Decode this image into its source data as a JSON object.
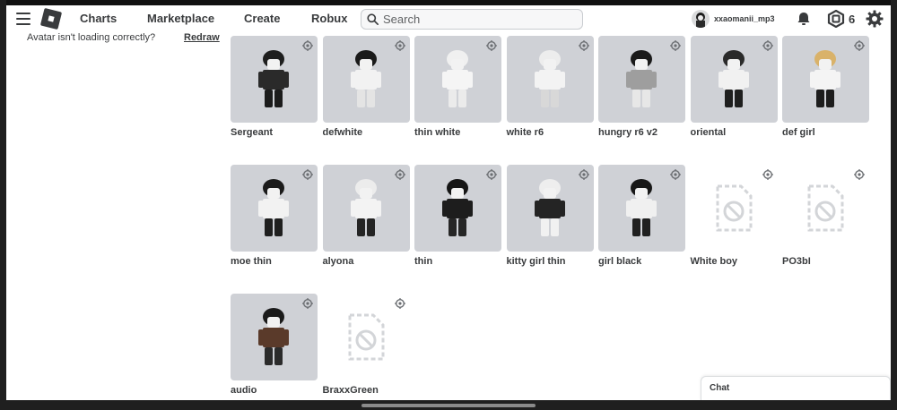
{
  "nav": {
    "menu_icon": "hamburger-icon",
    "logo_icon": "roblox-logo-icon",
    "links": [
      "Charts",
      "Marketplace",
      "Create",
      "Robux"
    ],
    "search_placeholder": "Search",
    "username": "xxaomanii_mp3",
    "robux_count": "6",
    "icons": [
      "bell-icon",
      "robux-icon",
      "gear-icon"
    ]
  },
  "avatar_message": "Avatar isn't loading correctly?",
  "redraw_label": "Redraw",
  "outfits": [
    {
      "name": "Sergeant",
      "loaded": true,
      "hair": "#1e1e1e",
      "shirt": "#2a2a2a",
      "pants": "#1c1c1c"
    },
    {
      "name": "defwhite",
      "loaded": true,
      "hair": "#1a1a1a",
      "shirt": "#f2f2f2",
      "pants": "#e4e4e4"
    },
    {
      "name": "thin white",
      "loaded": true,
      "hair": "#f0f0f0",
      "shirt": "#f5f5f5",
      "pants": "#ebebeb"
    },
    {
      "name": "white r6",
      "loaded": true,
      "hair": "#ededed",
      "shirt": "#f3f3f3",
      "pants": "#d8d8d8"
    },
    {
      "name": "hungry r6 v2",
      "loaded": true,
      "hair": "#1a1a1a",
      "shirt": "#9e9e9e",
      "pants": "#e7e7e7"
    },
    {
      "name": "oriental",
      "loaded": true,
      "hair": "#2a2a2a",
      "shirt": "#f1f1f1",
      "pants": "#1f1f1f"
    },
    {
      "name": "def girl",
      "loaded": true,
      "hair": "#d9b26a",
      "shirt": "#f4f4f4",
      "pants": "#1d1d1d"
    },
    {
      "name": "moe thin",
      "loaded": true,
      "hair": "#1b1b1b",
      "shirt": "#f2f2f2",
      "pants": "#1f1f1f"
    },
    {
      "name": "alyona",
      "loaded": true,
      "hair": "#ececec",
      "shirt": "#f3f3f3",
      "pants": "#242424"
    },
    {
      "name": "thin",
      "loaded": true,
      "hair": "#151515",
      "shirt": "#1d1d1d",
      "pants": "#262626"
    },
    {
      "name": "kitty girl thin",
      "loaded": true,
      "hair": "#eeeeee",
      "shirt": "#242424",
      "pants": "#f1f1f1"
    },
    {
      "name": "girl black",
      "loaded": true,
      "hair": "#171717",
      "shirt": "#f0f0f0",
      "pants": "#202020"
    },
    {
      "name": "White boy",
      "loaded": false
    },
    {
      "name": "PO3bI",
      "loaded": false
    },
    {
      "name": "audio",
      "loaded": true,
      "hair": "#1b1b1b",
      "shirt": "#5a3a2a",
      "pants": "#2b2b2b"
    },
    {
      "name": "BraxxGreen",
      "loaded": false
    }
  ],
  "chat_label": "Chat"
}
